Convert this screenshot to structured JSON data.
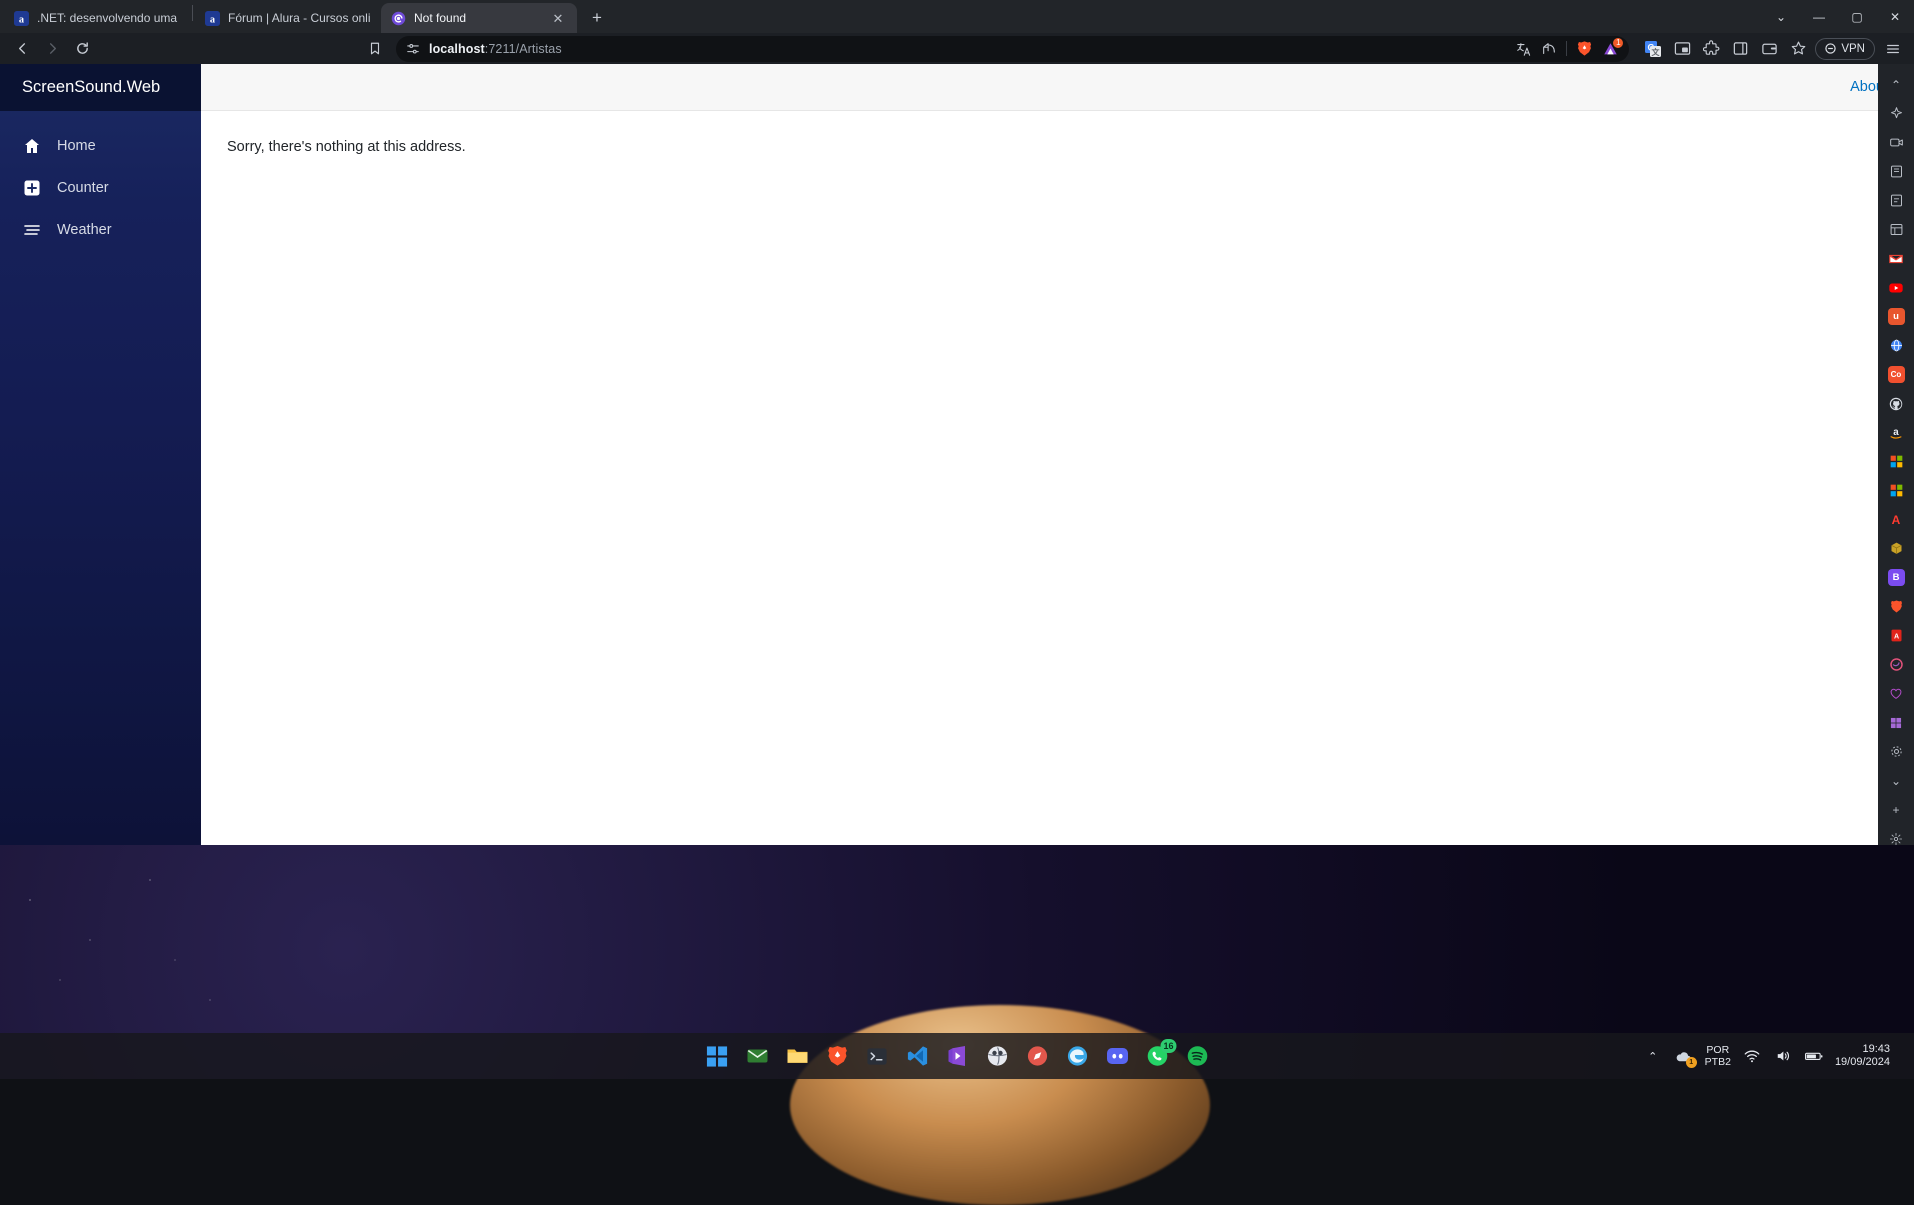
{
  "browser": {
    "tabs": [
      {
        "title": ".NET: desenvolvendo uma aplicação",
        "favicon": "alura-icon",
        "active": false
      },
      {
        "title": "Fórum | Alura - Cursos online de tec",
        "favicon": "alura-icon",
        "active": false
      },
      {
        "title": "Not found",
        "favicon": "blazor-icon",
        "active": true
      }
    ],
    "new_tab_label": "+",
    "window_controls": {
      "minimize_all": "⌄",
      "minimize": "—",
      "maximize": "▢",
      "close": "✕"
    },
    "toolbar": {
      "back_label": "‹",
      "forward_label": "›",
      "reload_label": "⟳",
      "bookmark_label": "bookmark",
      "url_prefix": "localhost",
      "url_suffix": ":7211/Artistas",
      "url_full": "localhost:7211/Artistas",
      "shield_badge": "1",
      "vpn_label": "VPN",
      "icons": {
        "site_settings": "tune-icon",
        "translate": "translate-icon",
        "share": "share-icon",
        "brave_shields": "brave-lion-icon",
        "brave_rewards": "brave-rewards-triangle-icon",
        "google_translate_ext": "google-translate-extension-icon",
        "picture_in_picture": "picture-in-picture-icon",
        "extensions": "puzzle-piece-icon",
        "sidebar_toggle": "sidebar-panel-icon",
        "wallet": "brave-wallet-icon",
        "bookmark_star": "bookmark-star-icon",
        "menu": "hamburger-menu-icon"
      }
    },
    "sidebar_strip": [
      {
        "name": "collapse-chevron-up-icon",
        "glyph": "⌃"
      },
      {
        "name": "brave-leo-ai-icon",
        "glyph": "✦"
      },
      {
        "name": "brave-talk-icon",
        "glyph": "▭"
      },
      {
        "name": "bookmarks-icon",
        "glyph": "▤"
      },
      {
        "name": "reading-list-icon",
        "glyph": "▤"
      },
      {
        "name": "playlist-icon",
        "glyph": "▦"
      },
      {
        "name": "gmail-icon",
        "glyph": "M",
        "color": "#ea4335"
      },
      {
        "name": "youtube-icon",
        "glyph": "▶",
        "color": "#ff0000"
      },
      {
        "name": "udemy-icon",
        "glyph": "u",
        "color": "#a435f0"
      },
      {
        "name": "globe-icon",
        "glyph": "◍",
        "color": "#4285f4"
      },
      {
        "name": "codepen-icon",
        "glyph": "Co",
        "color": "#ff5722"
      },
      {
        "name": "github-icon",
        "glyph": "",
        "color": "#d8dde4"
      },
      {
        "name": "amazon-icon",
        "glyph": "a",
        "color": "#ff9900"
      },
      {
        "name": "microsoft-store-icon",
        "glyph": "▤",
        "color": "#00a4ef"
      },
      {
        "name": "microsoft-365-icon",
        "glyph": "▤",
        "color": "#f25022"
      },
      {
        "name": "adobe-icon",
        "glyph": "A",
        "color": "#ff0000"
      },
      {
        "name": "package-icon",
        "glyph": "◆",
        "color": "#c9a227"
      },
      {
        "name": "bitwarden-icon",
        "glyph": "B",
        "color": "#175ddc"
      },
      {
        "name": "brave-icon",
        "glyph": "◆",
        "color": "#fb542b"
      },
      {
        "name": "acrobat-icon",
        "glyph": "A",
        "color": "#e2231a"
      },
      {
        "name": "firefox-icon",
        "glyph": "◐",
        "color": "#ff7139"
      },
      {
        "name": "heart-icon",
        "glyph": "♥",
        "color": "#b14cc8"
      },
      {
        "name": "windows-icon",
        "glyph": "▦",
        "color": "#9b59b6"
      },
      {
        "name": "settings-gear-icon",
        "glyph": "⚙"
      },
      {
        "name": "expand-chevron-down-icon",
        "glyph": "⌄"
      },
      {
        "name": "add-icon",
        "glyph": "+"
      },
      {
        "name": "sidebar-settings-icon",
        "glyph": "⚙"
      }
    ]
  },
  "app": {
    "brand": "ScreenSound.Web",
    "nav_items": [
      {
        "label": "Home",
        "icon": "home-icon"
      },
      {
        "label": "Counter",
        "icon": "plus-square-icon"
      },
      {
        "label": "Weather",
        "icon": "list-lines-icon"
      }
    ],
    "topbar": {
      "about_label": "About"
    },
    "content": {
      "message": "Sorry, there's nothing at this address."
    },
    "colors": {
      "sidebar_top": "#0a1232",
      "sidebar_gradient_start": "#1b2a63",
      "sidebar_gradient_end": "#0d1238",
      "link": "#0071c1",
      "topbar_bg": "#f7f7f7",
      "content_text": "#212529"
    }
  },
  "taskbar": {
    "items": [
      {
        "name": "start-windows-icon",
        "glyph": "▦"
      },
      {
        "name": "mail-icon",
        "glyph": "✉"
      },
      {
        "name": "file-explorer-icon",
        "glyph": "🗀"
      },
      {
        "name": "brave-browser-icon",
        "glyph": "◆"
      },
      {
        "name": "terminal-icon",
        "glyph": ">_"
      },
      {
        "name": "visual-studio-code-icon",
        "glyph": "◣"
      },
      {
        "name": "visual-studio-icon",
        "glyph": "N"
      },
      {
        "name": "game-app-icon",
        "glyph": "◓"
      },
      {
        "name": "compass-app-icon",
        "glyph": "◉"
      },
      {
        "name": "edge-browser-icon",
        "glyph": "◉"
      },
      {
        "name": "discord-icon",
        "glyph": "◍"
      },
      {
        "name": "whatsapp-icon",
        "glyph": "✆",
        "badge": "16"
      },
      {
        "name": "spotify-icon",
        "glyph": "♫"
      }
    ],
    "tray": {
      "overflow_label": "⌃",
      "onedrive_badge": "1",
      "language_top": "POR",
      "language_bottom": "PTB2",
      "wifi_icon": "wifi-icon",
      "volume_icon": "volume-icon",
      "battery_icon": "battery-icon",
      "time": "19:43",
      "date": "19/09/2024"
    }
  }
}
